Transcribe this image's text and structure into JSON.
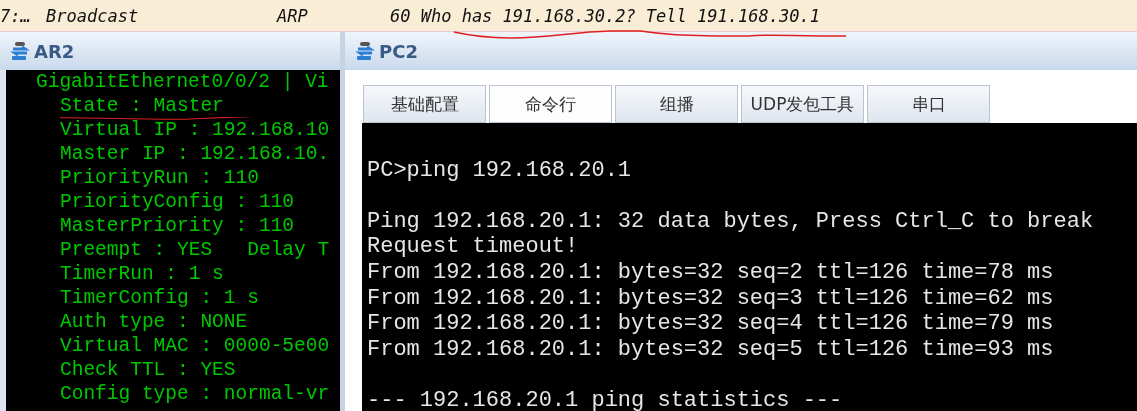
{
  "packet_row": {
    "cells": [
      "7:…",
      "Broadcast",
      "ARP",
      "60 Who has 191.168.30.2? Tell 191.168.30.1"
    ]
  },
  "ar2": {
    "title": "AR2",
    "terminal": {
      "header": "GigabitEthernet0/0/2 | Vi",
      "lines": [
        "State : Master",
        "Virtual IP : 192.168.10",
        "Master IP : 192.168.10.",
        "PriorityRun : 110",
        "PriorityConfig : 110",
        "MasterPriority : 110",
        "Preempt : YES   Delay T",
        "TimerRun : 1 s",
        "TimerConfig : 1 s",
        "Auth type : NONE",
        "Virtual MAC : 0000-5e00",
        "Check TTL : YES",
        "Config type : normal-vr"
      ]
    }
  },
  "pc2": {
    "title": "PC2",
    "tabs": [
      {
        "label": "基础配置",
        "selected": false
      },
      {
        "label": "命令行",
        "selected": true
      },
      {
        "label": "组播",
        "selected": false
      },
      {
        "label": "UDP发包工具",
        "selected": false
      },
      {
        "label": "串口",
        "selected": false
      }
    ],
    "terminal": {
      "blocks": [
        {
          "lines": [
            "PC>ping 192.168.20.1"
          ]
        },
        {
          "lines": [
            "Ping 192.168.20.1: 32 data bytes, Press Ctrl_C to break",
            "Request timeout!",
            "From 192.168.20.1: bytes=32 seq=2 ttl=126 time=78 ms",
            "From 192.168.20.1: bytes=32 seq=3 ttl=126 time=62 ms",
            "From 192.168.20.1: bytes=32 seq=4 ttl=126 time=79 ms",
            "From 192.168.20.1: bytes=32 seq=5 ttl=126 time=93 ms"
          ]
        },
        {
          "lines": [
            "--- 192.168.20.1 ping statistics ---"
          ]
        }
      ]
    }
  }
}
